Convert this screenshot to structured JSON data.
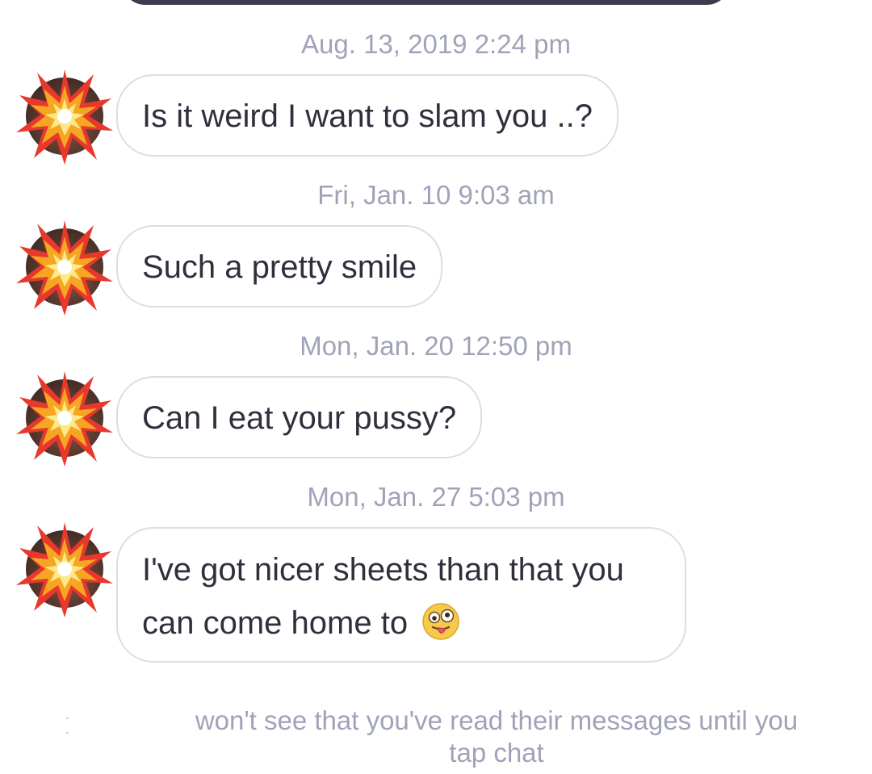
{
  "conversation": {
    "messages": [
      {
        "timestamp": "Aug. 13, 2019 2:24 pm",
        "text": "Is it weird I want to slam you ..?"
      },
      {
        "timestamp": "Fri, Jan. 10 9:03 am",
        "text": "Such a pretty smile"
      },
      {
        "timestamp": "Mon, Jan. 20 12:50 pm",
        "text": "Can I eat your pussy?"
      },
      {
        "timestamp": "Mon, Jan. 27 5:03 pm",
        "text_line1": "I've got nicer sheets than that you",
        "text_line2": "can come home to",
        "emoji": "zany-face-emoji"
      }
    ],
    "avatar_icon": "collision-emoji-icon"
  },
  "footer": {
    "read_notice_line1": "won't see that you've read their messages until you",
    "read_notice_line2": "tap chat"
  },
  "colors": {
    "timestamp": "#a0a3b8",
    "bubble_border": "#dcdde6",
    "bubble_text": "#2f303d",
    "top_bar": "#3c3e4e"
  }
}
